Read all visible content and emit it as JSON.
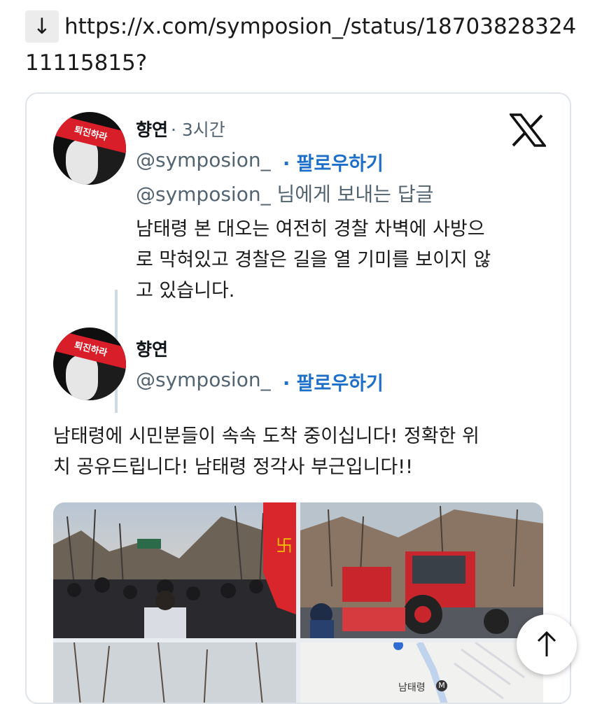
{
  "header": {
    "arrow": "↓",
    "url": "https://x.com/symposion_/status/1870382832411115815?"
  },
  "tweet1": {
    "name": "향연",
    "time": "· 3시간",
    "handle": "@symposion_",
    "follow": "· 팔로우하기",
    "replying_to": "@symposion_ 님에게 보내는 답글",
    "body_lines": [
      "남태령 본 대오는 여전히 경찰 차벽에 사방으",
      "로 막혀있고 경찰은 길을 열 기미를 보이지 않",
      "고 있습니다."
    ]
  },
  "tweet2": {
    "name": "향연",
    "handle": "@symposion_",
    "follow": "· 팔로우하기",
    "body_lines": [
      "남태령에 시민분들이 속속 도착 중이십니다! 정확한 위",
      "치 공유드립니다! 남태령 정각사 부근입니다!!"
    ]
  },
  "avatar": {
    "band_text": "퇴진하라"
  },
  "media": {
    "map_label": "남태령",
    "map_marker": "M"
  },
  "colors": {
    "link": "#1d6fc9",
    "secondary": "#536471",
    "border": "#dfe4ea"
  },
  "icons": [
    "down-arrow-icon",
    "x-logo-icon",
    "arrow-up-icon"
  ]
}
